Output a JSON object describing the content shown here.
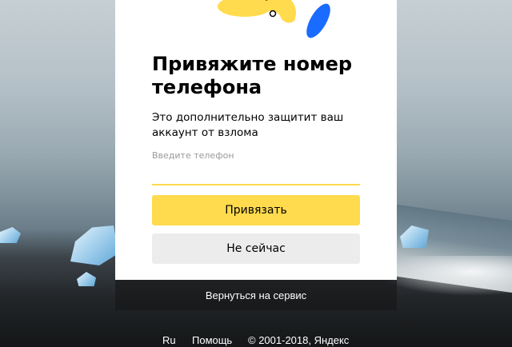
{
  "card": {
    "title": "Привяжите номер телефона",
    "subtitle": "Это дополнительно защитит ваш аккаунт от взлома",
    "phone_label": "Введите телефон",
    "phone_value": "",
    "bind_button": "Привязать",
    "skip_button": "Не сейчас"
  },
  "return_link": "Вернуться на сервис",
  "footer": {
    "language": "Ru",
    "help": "Помощь",
    "copyright": "© 2001-2018, Яндекс"
  },
  "colors": {
    "accent_yellow": "#ffdb4d",
    "secondary_gray": "#ececec",
    "illustration_blue": "#1a6bff"
  },
  "icons": {
    "illustration": "yellow-blue-illustration"
  }
}
